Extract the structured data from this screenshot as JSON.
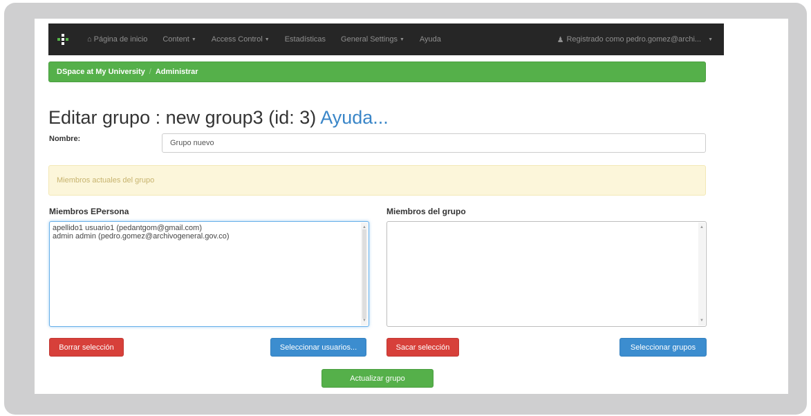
{
  "navbar": {
    "home_label": "Página de inicio",
    "content_label": "Content",
    "access_control_label": "Access Control",
    "stats_label": "Estadísticas",
    "general_settings_label": "General Settings",
    "help_label": "Ayuda",
    "user_label": "Registrado como pedro.gomez@archi..."
  },
  "breadcrumb": {
    "site": "DSpace at My University",
    "separator": "/",
    "current": "Administrar"
  },
  "page": {
    "title": "Editar grupo : new group3 (id: 3)",
    "help_link": "Ayuda..."
  },
  "form": {
    "name_label": "Nombre:",
    "name_value": "Grupo nuevo",
    "notice": "Miembros actuales del grupo",
    "epersons_label": "Miembros EPersona",
    "epersons": [
      "apellido1 usuario1 (pedantgom@gmail.com)",
      "admin admin (pedro.gomez@archivogeneral.gov.co)"
    ],
    "groups_label": "Miembros del grupo",
    "groups": []
  },
  "buttons": {
    "clear_selection": "Borrar selección",
    "select_users": "Seleccionar usuarios...",
    "remove_selection": "Sacar selección",
    "select_groups": "Seleccionar grupos",
    "update_group": "Actualizar grupo"
  },
  "colors": {
    "navbar": "#262626",
    "brand_green": "#55b04a",
    "danger_red": "#d7403a",
    "primary_blue": "#3c8dcf",
    "notice_yellow": "#fcf6da"
  }
}
